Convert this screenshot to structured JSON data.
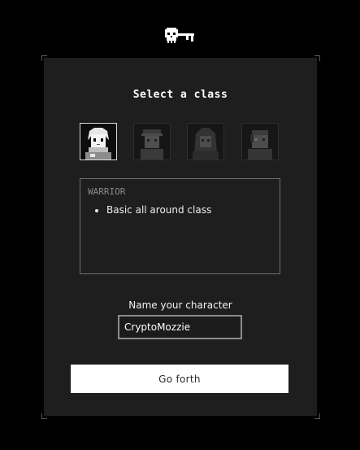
{
  "header": {
    "logo_icon": "skull-key-icon"
  },
  "panel": {
    "title": "Select a class",
    "classes": [
      {
        "portrait_icon": "warrior-portrait-icon",
        "selected": true
      },
      {
        "portrait_icon": "soldier-portrait-icon",
        "selected": false
      },
      {
        "portrait_icon": "hooded-portrait-icon",
        "selected": false
      },
      {
        "portrait_icon": "cyborg-portrait-icon",
        "selected": false
      }
    ],
    "description": {
      "class_name": "WARRIOR",
      "bullets": [
        "Basic all around class"
      ]
    },
    "name_label": "Name your character",
    "name_value": "CryptoMozzie",
    "submit_label": "Go forth"
  },
  "colors": {
    "background": "#000000",
    "panel": "#1e1e1f",
    "button": "#ffffff",
    "selected_border": "#d8d8d8"
  }
}
